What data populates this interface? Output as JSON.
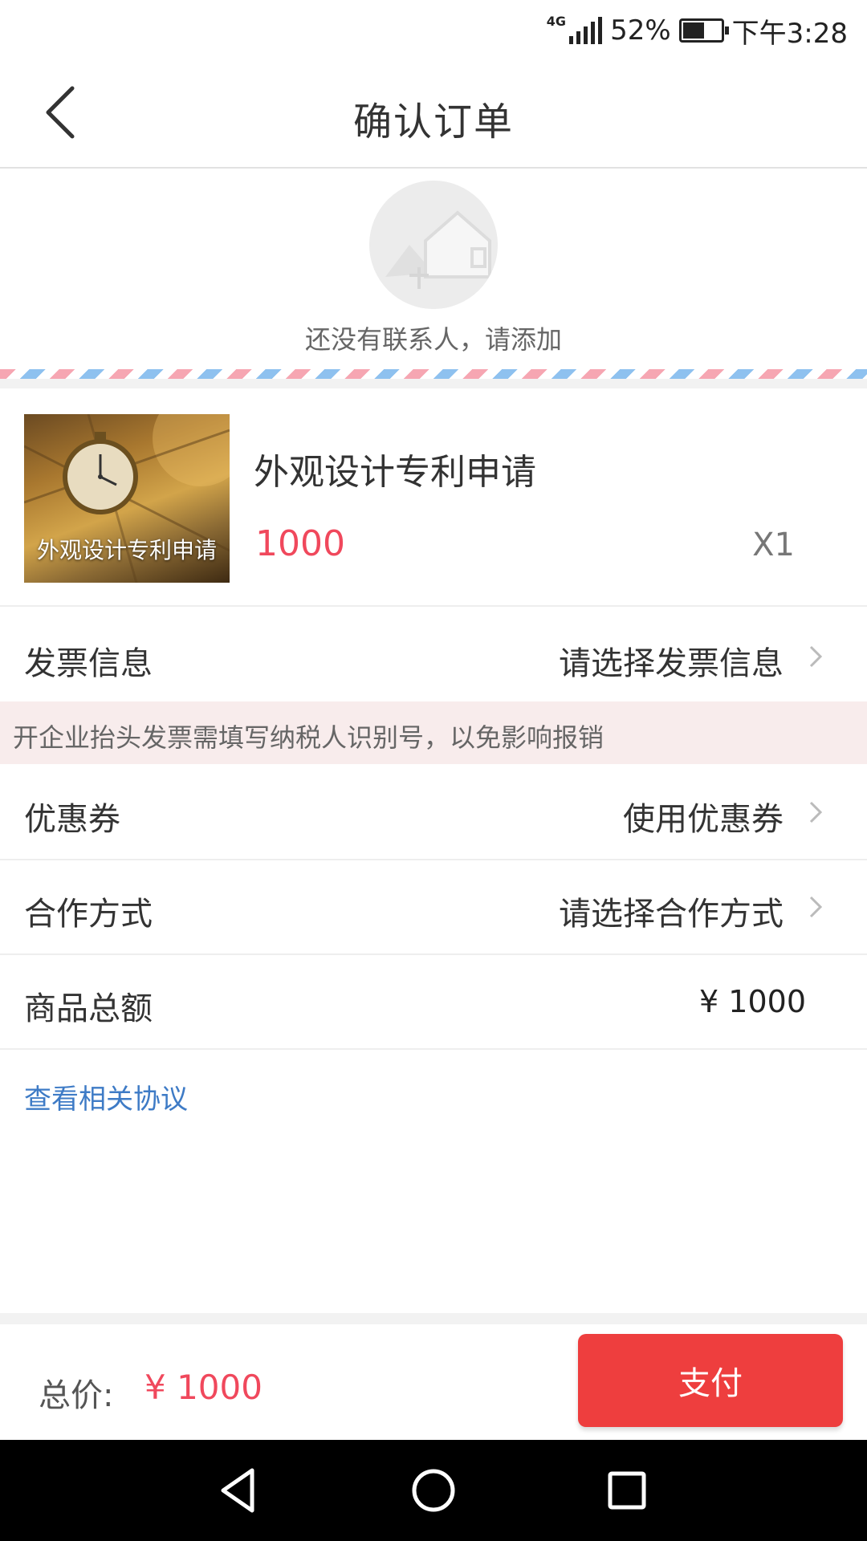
{
  "status_bar": {
    "network": "4G",
    "battery_percent": "52%",
    "battery_level": 0.52,
    "time": "下午3:28"
  },
  "header": {
    "title": "确认订单",
    "back_icon": "chevron-left-icon"
  },
  "contact": {
    "empty_text": "还没有联系人，请添加",
    "placeholder_icon": "house-placeholder-icon"
  },
  "product": {
    "image_caption": "外观设计专利申请",
    "name": "外观设计专利申请",
    "price": "1000",
    "quantity": "X1"
  },
  "rows": {
    "invoice": {
      "label": "发票信息",
      "value": "请选择发票信息"
    },
    "invoice_notice": "开企业抬头发票需填写纳税人识别号，以免影响报销",
    "coupon": {
      "label": "优惠券",
      "value": "使用优惠券"
    },
    "cooperation": {
      "label": "合作方式",
      "value": "请选择合作方式"
    },
    "subtotal": {
      "label": "商品总额",
      "value": "¥ 1000"
    }
  },
  "agreement_link": "查看相关协议",
  "footer": {
    "total_label": "总价:",
    "total_value": "¥ 1000",
    "pay_label": "支付"
  },
  "colors": {
    "accent_red": "#ee3e3e",
    "price_red": "#f0485c",
    "link_blue": "#3e7bc6",
    "notice_bg": "#f8ecec"
  },
  "nav_icons": [
    "nav-back-icon",
    "nav-home-icon",
    "nav-recents-icon"
  ]
}
